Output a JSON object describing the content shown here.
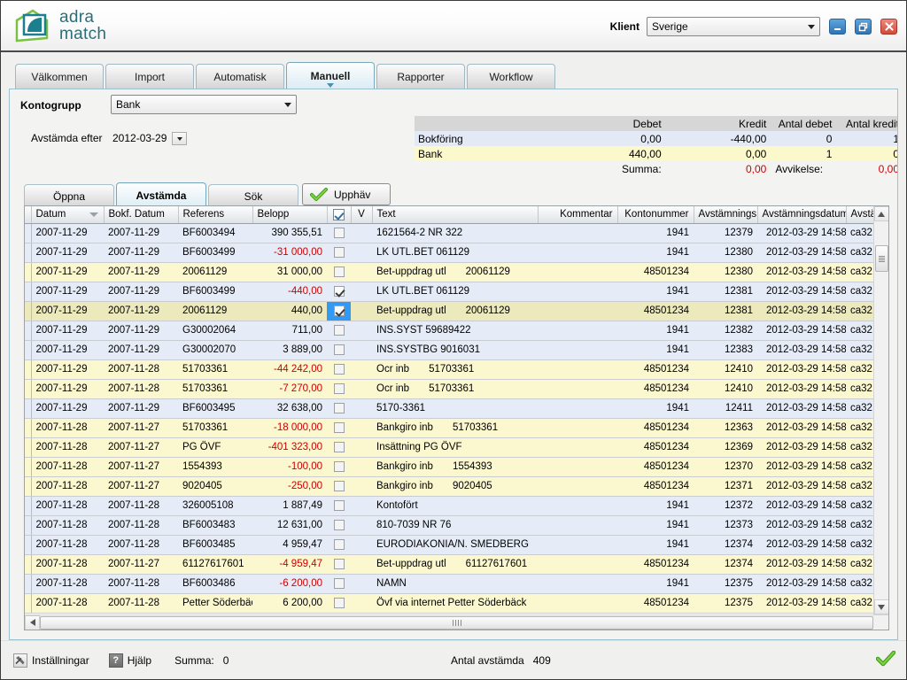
{
  "app": {
    "brand_line1": "adra",
    "brand_line2": "match",
    "client_label": "Klient",
    "client_value": "Sverige",
    "window_buttons": [
      "minimize-icon",
      "restore-icon",
      "close-icon"
    ]
  },
  "tabs": [
    {
      "label": "Välkommen",
      "active": false
    },
    {
      "label": "Import",
      "active": false
    },
    {
      "label": "Automatisk",
      "active": false
    },
    {
      "label": "Manuell",
      "active": true
    },
    {
      "label": "Rapporter",
      "active": false
    },
    {
      "label": "Workflow",
      "active": false
    }
  ],
  "filters": {
    "kontogrupp_label": "Kontogrupp",
    "kontogrupp_value": "Bank",
    "avstamda_label": "Avstämda efter",
    "avstamda_value": "2012-03-29"
  },
  "summary": {
    "headers": [
      "",
      "Debet",
      "Kredit",
      "Antal debet",
      "Antal kredit"
    ],
    "rows": [
      {
        "label": "Bokföring",
        "debet": "0,00",
        "kredit": "-440,00",
        "antal_debet": "0",
        "antal_kredit": "1"
      },
      {
        "label": "Bank",
        "debet": "440,00",
        "kredit": "0,00",
        "antal_debet": "1",
        "antal_kredit": "0"
      }
    ],
    "summa_label": "Summa:",
    "summa_value": "0,00",
    "avvikelse_label": "Avvikelse:",
    "avvikelse_value": "0,00"
  },
  "subtabs": [
    {
      "label": "Öppna",
      "active": false
    },
    {
      "label": "Avstämda",
      "active": true
    },
    {
      "label": "Sök",
      "active": false
    }
  ],
  "upphav_button": "Upphäv",
  "grid": {
    "columns": [
      {
        "key": "datum",
        "label": "Datum",
        "sorted": true
      },
      {
        "key": "bokf_datum",
        "label": "Bokf. Datum"
      },
      {
        "key": "referens",
        "label": "Referens"
      },
      {
        "key": "belopp",
        "label": "Belopp",
        "align": "right"
      },
      {
        "key": "check",
        "label": "",
        "header_checkbox": true
      },
      {
        "key": "v",
        "label": "V"
      },
      {
        "key": "text",
        "label": "Text"
      },
      {
        "key": "kommentar",
        "label": "Kommentar",
        "align": "right"
      },
      {
        "key": "kontonummer",
        "label": "Kontonummer",
        "align": "right"
      },
      {
        "key": "avstamnings",
        "label": "Avstämnings",
        "align": "right"
      },
      {
        "key": "avstamningsdatum",
        "label": "Avstämningsdatum"
      },
      {
        "key": "avstamd_av",
        "label": "Avstämd a"
      }
    ],
    "rows": [
      {
        "datum": "2007-11-29",
        "bokf_datum": "2007-11-29",
        "referens": "BF6003494",
        "belopp": "390 355,51",
        "negative": false,
        "checked": false,
        "text": "1621564-2 NR 322",
        "text2": "",
        "kommentar": "",
        "kontonummer": "1941",
        "avstamnings": "12379",
        "avstamningsdatum": "2012-03-29 14:58",
        "avstamd_av": "ca32",
        "shade": "blue"
      },
      {
        "datum": "2007-11-29",
        "bokf_datum": "2007-11-29",
        "referens": "BF6003499",
        "belopp": "-31 000,00",
        "negative": true,
        "checked": false,
        "text": "LK UTL.BET 061129",
        "text2": "",
        "kommentar": "",
        "kontonummer": "1941",
        "avstamnings": "12380",
        "avstamningsdatum": "2012-03-29 14:58",
        "avstamd_av": "ca32",
        "shade": "blue"
      },
      {
        "datum": "2007-11-29",
        "bokf_datum": "2007-11-29",
        "referens": "20061129",
        "belopp": "31 000,00",
        "negative": false,
        "checked": false,
        "text": "Bet-uppdrag utl",
        "text2": "20061129",
        "kommentar": "",
        "kontonummer": "48501234",
        "avstamnings": "12380",
        "avstamningsdatum": "2012-03-29 14:58",
        "avstamd_av": "ca32",
        "shade": "yellow"
      },
      {
        "datum": "2007-11-29",
        "bokf_datum": "2007-11-29",
        "referens": "BF6003499",
        "belopp": "-440,00",
        "negative": true,
        "checked": true,
        "text": "LK UTL.BET 061129",
        "text2": "",
        "kommentar": "",
        "kontonummer": "1941",
        "avstamnings": "12381",
        "avstamningsdatum": "2012-03-29 14:58",
        "avstamd_av": "ca32",
        "shade": "blue"
      },
      {
        "datum": "2007-11-29",
        "bokf_datum": "2007-11-29",
        "referens": "20061129",
        "belopp": "440,00",
        "negative": false,
        "checked": true,
        "highlight_check": true,
        "text": "Bet-uppdrag utl",
        "text2": "20061129",
        "kommentar": "",
        "kontonummer": "48501234",
        "avstamnings": "12381",
        "avstamningsdatum": "2012-03-29 14:58",
        "avstamd_av": "ca32",
        "shade": "selected"
      },
      {
        "datum": "2007-11-29",
        "bokf_datum": "2007-11-29",
        "referens": "G30002064",
        "belopp": "711,00",
        "negative": false,
        "checked": false,
        "text": "INS.SYST 59689422",
        "text2": "",
        "kommentar": "",
        "kontonummer": "1941",
        "avstamnings": "12382",
        "avstamningsdatum": "2012-03-29 14:58",
        "avstamd_av": "ca32",
        "shade": "blue"
      },
      {
        "datum": "2007-11-29",
        "bokf_datum": "2007-11-29",
        "referens": "G30002070",
        "belopp": "3 889,00",
        "negative": false,
        "checked": false,
        "text": "INS.SYSTBG 9016031",
        "text2": "",
        "kommentar": "",
        "kontonummer": "1941",
        "avstamnings": "12383",
        "avstamningsdatum": "2012-03-29 14:58",
        "avstamd_av": "ca32",
        "shade": "blue"
      },
      {
        "datum": "2007-11-29",
        "bokf_datum": "2007-11-28",
        "referens": "51703361",
        "belopp": "-44 242,00",
        "negative": true,
        "checked": false,
        "text": "Ocr inb",
        "text2": "51703361",
        "kommentar": "",
        "kontonummer": "48501234",
        "avstamnings": "12410",
        "avstamningsdatum": "2012-03-29 14:58",
        "avstamd_av": "ca32",
        "shade": "yellow"
      },
      {
        "datum": "2007-11-29",
        "bokf_datum": "2007-11-28",
        "referens": "51703361",
        "belopp": "-7 270,00",
        "negative": true,
        "checked": false,
        "text": "Ocr inb",
        "text2": "51703361",
        "kommentar": "",
        "kontonummer": "48501234",
        "avstamnings": "12410",
        "avstamningsdatum": "2012-03-29 14:58",
        "avstamd_av": "ca32",
        "shade": "yellow"
      },
      {
        "datum": "2007-11-29",
        "bokf_datum": "2007-11-29",
        "referens": "BF6003495",
        "belopp": "32 638,00",
        "negative": false,
        "checked": false,
        "text": "5170-3361",
        "text2": "",
        "kommentar": "",
        "kontonummer": "1941",
        "avstamnings": "12411",
        "avstamningsdatum": "2012-03-29 14:58",
        "avstamd_av": "ca32",
        "shade": "blue"
      },
      {
        "datum": "2007-11-28",
        "bokf_datum": "2007-11-27",
        "referens": "51703361",
        "belopp": "-18 000,00",
        "negative": true,
        "checked": false,
        "text": "Bankgiro inb",
        "text2": "51703361",
        "kommentar": "",
        "kontonummer": "48501234",
        "avstamnings": "12363",
        "avstamningsdatum": "2012-03-29 14:58",
        "avstamd_av": "ca32",
        "shade": "yellow"
      },
      {
        "datum": "2007-11-28",
        "bokf_datum": "2007-11-27",
        "referens": "PG ÖVF",
        "belopp": "-401 323,00",
        "negative": true,
        "checked": false,
        "text": "Insättning PG ÖVF",
        "text2": "",
        "kommentar": "",
        "kontonummer": "48501234",
        "avstamnings": "12369",
        "avstamningsdatum": "2012-03-29 14:58",
        "avstamd_av": "ca32",
        "shade": "yellow"
      },
      {
        "datum": "2007-11-28",
        "bokf_datum": "2007-11-27",
        "referens": "1554393",
        "belopp": "-100,00",
        "negative": true,
        "checked": false,
        "text": "Bankgiro inb",
        "text2": "1554393",
        "kommentar": "",
        "kontonummer": "48501234",
        "avstamnings": "12370",
        "avstamningsdatum": "2012-03-29 14:58",
        "avstamd_av": "ca32",
        "shade": "yellow"
      },
      {
        "datum": "2007-11-28",
        "bokf_datum": "2007-11-27",
        "referens": "9020405",
        "belopp": "-250,00",
        "negative": true,
        "checked": false,
        "text": "Bankgiro inb",
        "text2": "9020405",
        "kommentar": "",
        "kontonummer": "48501234",
        "avstamnings": "12371",
        "avstamningsdatum": "2012-03-29 14:58",
        "avstamd_av": "ca32",
        "shade": "yellow"
      },
      {
        "datum": "2007-11-28",
        "bokf_datum": "2007-11-28",
        "referens": "326005108",
        "belopp": "1 887,49",
        "negative": false,
        "checked": false,
        "text": "Kontofört",
        "text2": "",
        "kommentar": "",
        "kontonummer": "1941",
        "avstamnings": "12372",
        "avstamningsdatum": "2012-03-29 14:58",
        "avstamd_av": "ca32",
        "shade": "blue"
      },
      {
        "datum": "2007-11-28",
        "bokf_datum": "2007-11-28",
        "referens": "BF6003483",
        "belopp": "12 631,00",
        "negative": false,
        "checked": false,
        "text": "810-7039 NR 76",
        "text2": "",
        "kommentar": "",
        "kontonummer": "1941",
        "avstamnings": "12373",
        "avstamningsdatum": "2012-03-29 14:58",
        "avstamd_av": "ca32",
        "shade": "blue"
      },
      {
        "datum": "2007-11-28",
        "bokf_datum": "2007-11-28",
        "referens": "BF6003485",
        "belopp": "4 959,47",
        "negative": false,
        "checked": false,
        "text": "EURODIAKONIA/N. SMEDBERG",
        "text2": "",
        "kommentar": "",
        "kontonummer": "1941",
        "avstamnings": "12374",
        "avstamningsdatum": "2012-03-29 14:58",
        "avstamd_av": "ca32",
        "shade": "blue"
      },
      {
        "datum": "2007-11-28",
        "bokf_datum": "2007-11-27",
        "referens": "61127617601",
        "belopp": "-4 959,47",
        "negative": true,
        "checked": false,
        "text": "Bet-uppdrag utl",
        "text2": "61127617601",
        "kommentar": "",
        "kontonummer": "48501234",
        "avstamnings": "12374",
        "avstamningsdatum": "2012-03-29 14:58",
        "avstamd_av": "ca32",
        "shade": "yellow"
      },
      {
        "datum": "2007-11-28",
        "bokf_datum": "2007-11-28",
        "referens": "BF6003486",
        "belopp": "-6 200,00",
        "negative": true,
        "checked": false,
        "text": "NAMN",
        "text2": "",
        "kommentar": "",
        "kontonummer": "1941",
        "avstamnings": "12375",
        "avstamningsdatum": "2012-03-29 14:58",
        "avstamd_av": "ca32",
        "shade": "blue"
      },
      {
        "datum": "2007-11-28",
        "bokf_datum": "2007-11-28",
        "referens": "Petter Söderbäck",
        "belopp": "6 200,00",
        "negative": false,
        "checked": false,
        "text": "Övf via internet Petter Söderbäck",
        "text2": "",
        "kommentar": "",
        "kontonummer": "48501234",
        "avstamnings": "12375",
        "avstamningsdatum": "2012-03-29 14:58",
        "avstamd_av": "ca32",
        "shade": "yellow",
        "wrap": true
      }
    ]
  },
  "statusbar": {
    "settings_label": "Inställningar",
    "help_label": "Hjälp",
    "summa_label": "Summa:",
    "summa_value": "0",
    "antal_label": "Antal avstämda",
    "antal_value": "409"
  },
  "colors": {
    "accent": "#2a6e7c",
    "negative": "#cc0000",
    "row_blue": "#e6ecf7",
    "row_yellow": "#fbf7cf",
    "selection": "#3399f3",
    "ok_green": "#5eb22e"
  }
}
